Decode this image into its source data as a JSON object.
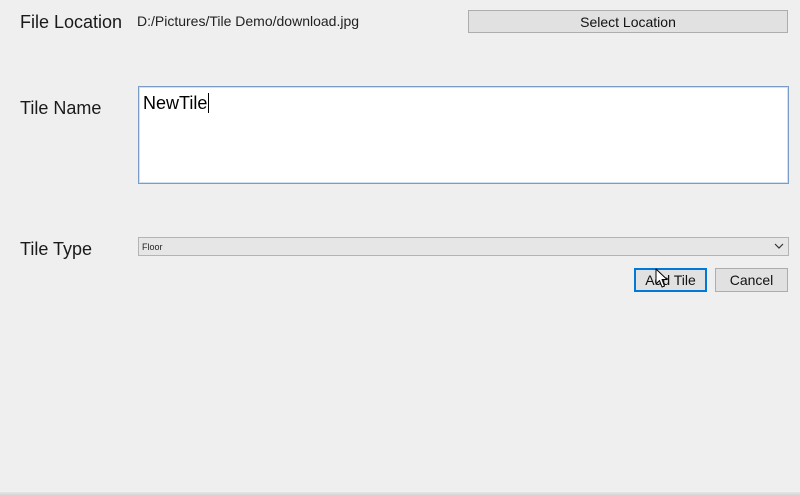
{
  "file_location": {
    "label": "File Location",
    "path": "D:/Pictures/Tile Demo/download.jpg",
    "select_button_label": "Select Location"
  },
  "tile_name": {
    "label": "Tile Name",
    "value": "NewTile"
  },
  "tile_type": {
    "label": "Tile Type",
    "selected": "Floor"
  },
  "actions": {
    "add_label": "Add Tile",
    "cancel_label": "Cancel"
  },
  "colors": {
    "background": "#efefef",
    "focus_border": "#0078d7"
  },
  "icons": {
    "combo_arrow": "chevron-down-icon",
    "cursor": "mouse-pointer-icon"
  }
}
